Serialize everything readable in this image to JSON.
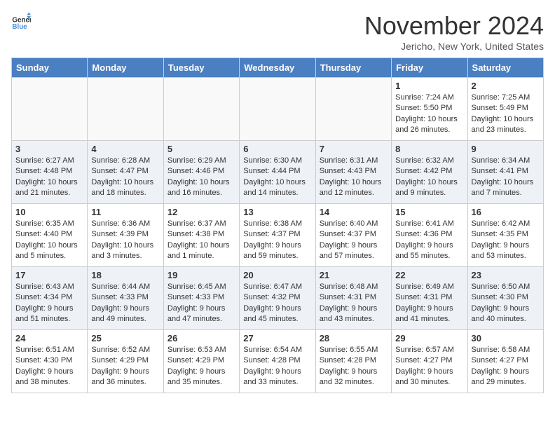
{
  "header": {
    "logo_general": "General",
    "logo_blue": "Blue",
    "month_title": "November 2024",
    "location": "Jericho, New York, United States"
  },
  "weekdays": [
    "Sunday",
    "Monday",
    "Tuesday",
    "Wednesday",
    "Thursday",
    "Friday",
    "Saturday"
  ],
  "weeks": [
    [
      {
        "day": "",
        "empty": true
      },
      {
        "day": "",
        "empty": true
      },
      {
        "day": "",
        "empty": true
      },
      {
        "day": "",
        "empty": true
      },
      {
        "day": "",
        "empty": true
      },
      {
        "day": "1",
        "sunrise": "Sunrise: 7:24 AM",
        "sunset": "Sunset: 5:50 PM",
        "daylight": "Daylight: 10 hours and 26 minutes."
      },
      {
        "day": "2",
        "sunrise": "Sunrise: 7:25 AM",
        "sunset": "Sunset: 5:49 PM",
        "daylight": "Daylight: 10 hours and 23 minutes."
      }
    ],
    [
      {
        "day": "3",
        "sunrise": "Sunrise: 6:27 AM",
        "sunset": "Sunset: 4:48 PM",
        "daylight": "Daylight: 10 hours and 21 minutes."
      },
      {
        "day": "4",
        "sunrise": "Sunrise: 6:28 AM",
        "sunset": "Sunset: 4:47 PM",
        "daylight": "Daylight: 10 hours and 18 minutes."
      },
      {
        "day": "5",
        "sunrise": "Sunrise: 6:29 AM",
        "sunset": "Sunset: 4:46 PM",
        "daylight": "Daylight: 10 hours and 16 minutes."
      },
      {
        "day": "6",
        "sunrise": "Sunrise: 6:30 AM",
        "sunset": "Sunset: 4:44 PM",
        "daylight": "Daylight: 10 hours and 14 minutes."
      },
      {
        "day": "7",
        "sunrise": "Sunrise: 6:31 AM",
        "sunset": "Sunset: 4:43 PM",
        "daylight": "Daylight: 10 hours and 12 minutes."
      },
      {
        "day": "8",
        "sunrise": "Sunrise: 6:32 AM",
        "sunset": "Sunset: 4:42 PM",
        "daylight": "Daylight: 10 hours and 9 minutes."
      },
      {
        "day": "9",
        "sunrise": "Sunrise: 6:34 AM",
        "sunset": "Sunset: 4:41 PM",
        "daylight": "Daylight: 10 hours and 7 minutes."
      }
    ],
    [
      {
        "day": "10",
        "sunrise": "Sunrise: 6:35 AM",
        "sunset": "Sunset: 4:40 PM",
        "daylight": "Daylight: 10 hours and 5 minutes."
      },
      {
        "day": "11",
        "sunrise": "Sunrise: 6:36 AM",
        "sunset": "Sunset: 4:39 PM",
        "daylight": "Daylight: 10 hours and 3 minutes."
      },
      {
        "day": "12",
        "sunrise": "Sunrise: 6:37 AM",
        "sunset": "Sunset: 4:38 PM",
        "daylight": "Daylight: 10 hours and 1 minute."
      },
      {
        "day": "13",
        "sunrise": "Sunrise: 6:38 AM",
        "sunset": "Sunset: 4:37 PM",
        "daylight": "Daylight: 9 hours and 59 minutes."
      },
      {
        "day": "14",
        "sunrise": "Sunrise: 6:40 AM",
        "sunset": "Sunset: 4:37 PM",
        "daylight": "Daylight: 9 hours and 57 minutes."
      },
      {
        "day": "15",
        "sunrise": "Sunrise: 6:41 AM",
        "sunset": "Sunset: 4:36 PM",
        "daylight": "Daylight: 9 hours and 55 minutes."
      },
      {
        "day": "16",
        "sunrise": "Sunrise: 6:42 AM",
        "sunset": "Sunset: 4:35 PM",
        "daylight": "Daylight: 9 hours and 53 minutes."
      }
    ],
    [
      {
        "day": "17",
        "sunrise": "Sunrise: 6:43 AM",
        "sunset": "Sunset: 4:34 PM",
        "daylight": "Daylight: 9 hours and 51 minutes."
      },
      {
        "day": "18",
        "sunrise": "Sunrise: 6:44 AM",
        "sunset": "Sunset: 4:33 PM",
        "daylight": "Daylight: 9 hours and 49 minutes."
      },
      {
        "day": "19",
        "sunrise": "Sunrise: 6:45 AM",
        "sunset": "Sunset: 4:33 PM",
        "daylight": "Daylight: 9 hours and 47 minutes."
      },
      {
        "day": "20",
        "sunrise": "Sunrise: 6:47 AM",
        "sunset": "Sunset: 4:32 PM",
        "daylight": "Daylight: 9 hours and 45 minutes."
      },
      {
        "day": "21",
        "sunrise": "Sunrise: 6:48 AM",
        "sunset": "Sunset: 4:31 PM",
        "daylight": "Daylight: 9 hours and 43 minutes."
      },
      {
        "day": "22",
        "sunrise": "Sunrise: 6:49 AM",
        "sunset": "Sunset: 4:31 PM",
        "daylight": "Daylight: 9 hours and 41 minutes."
      },
      {
        "day": "23",
        "sunrise": "Sunrise: 6:50 AM",
        "sunset": "Sunset: 4:30 PM",
        "daylight": "Daylight: 9 hours and 40 minutes."
      }
    ],
    [
      {
        "day": "24",
        "sunrise": "Sunrise: 6:51 AM",
        "sunset": "Sunset: 4:30 PM",
        "daylight": "Daylight: 9 hours and 38 minutes."
      },
      {
        "day": "25",
        "sunrise": "Sunrise: 6:52 AM",
        "sunset": "Sunset: 4:29 PM",
        "daylight": "Daylight: 9 hours and 36 minutes."
      },
      {
        "day": "26",
        "sunrise": "Sunrise: 6:53 AM",
        "sunset": "Sunset: 4:29 PM",
        "daylight": "Daylight: 9 hours and 35 minutes."
      },
      {
        "day": "27",
        "sunrise": "Sunrise: 6:54 AM",
        "sunset": "Sunset: 4:28 PM",
        "daylight": "Daylight: 9 hours and 33 minutes."
      },
      {
        "day": "28",
        "sunrise": "Sunrise: 6:55 AM",
        "sunset": "Sunset: 4:28 PM",
        "daylight": "Daylight: 9 hours and 32 minutes."
      },
      {
        "day": "29",
        "sunrise": "Sunrise: 6:57 AM",
        "sunset": "Sunset: 4:27 PM",
        "daylight": "Daylight: 9 hours and 30 minutes."
      },
      {
        "day": "30",
        "sunrise": "Sunrise: 6:58 AM",
        "sunset": "Sunset: 4:27 PM",
        "daylight": "Daylight: 9 hours and 29 minutes."
      }
    ]
  ]
}
